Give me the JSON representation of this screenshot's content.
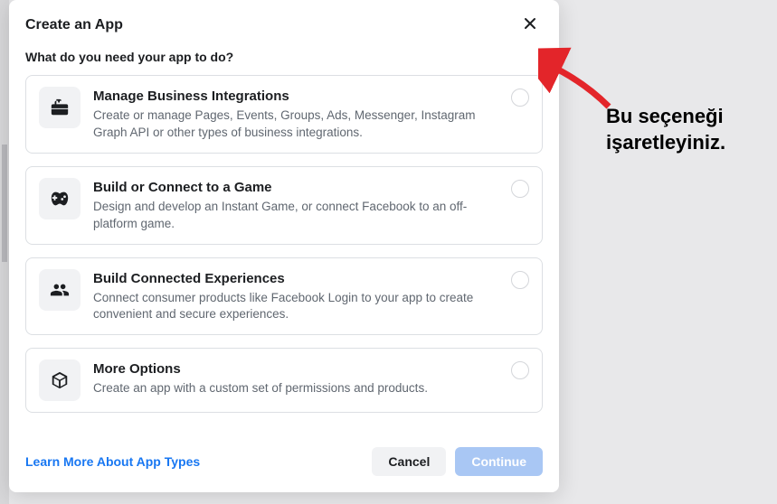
{
  "modal": {
    "title": "Create an App",
    "subtitle": "What do you need your app to do?",
    "options": [
      {
        "title": "Manage Business Integrations",
        "desc": "Create or manage Pages, Events, Groups, Ads, Messenger, Instagram Graph API or other types of business integrations."
      },
      {
        "title": "Build or Connect to a Game",
        "desc": "Design and develop an Instant Game, or connect Facebook to an off-platform game."
      },
      {
        "title": "Build Connected Experiences",
        "desc": "Connect consumer products like Facebook Login to your app to create convenient and secure experiences."
      },
      {
        "title": "More Options",
        "desc": "Create an app with a custom set of permissions and products."
      }
    ],
    "learn_more": "Learn More About App Types",
    "cancel": "Cancel",
    "continue": "Continue"
  },
  "annotation": {
    "text": "Bu seçeneği işaretleyiniz."
  }
}
